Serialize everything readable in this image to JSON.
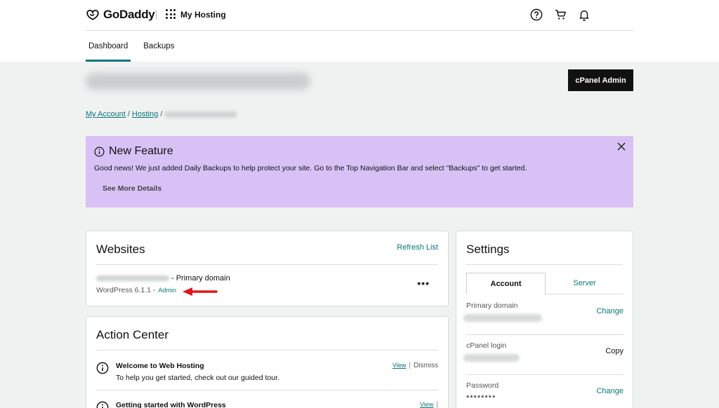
{
  "header": {
    "brand": "GoDaddy",
    "product": "My Hosting",
    "icons": [
      "help-icon",
      "cart-icon",
      "bell-icon"
    ]
  },
  "subnav": {
    "tabs": [
      {
        "label": "Dashboard",
        "active": true
      },
      {
        "label": "Backups",
        "active": false
      }
    ]
  },
  "title": {
    "cpanel_label": "cPanel Admin"
  },
  "breadcrumb": {
    "items": [
      "My Account",
      "Hosting"
    ],
    "separator": "/"
  },
  "banner": {
    "title": "New Feature",
    "body": "Good news! We just added Daily Backups to help protect your site. Go to the Top Navigation Bar and select \"Backups\" to get started.",
    "more_label": "See More Details",
    "close_icon": "close-icon",
    "color": "#d8c1f5"
  },
  "websites": {
    "title": "Websites",
    "refresh_label": "Refresh List",
    "site": {
      "domain_suffix": "- Primary domain",
      "platform": "WordPress 6.1.1 -",
      "admin_label": "Admin",
      "menu_label": "•••"
    }
  },
  "action_center": {
    "title": "Action Center",
    "items": [
      {
        "title": "Welcome to Web Hosting",
        "desc": "To help you get started, check out our guided tour.",
        "view_label": "View",
        "dismiss_label": "Dismiss"
      },
      {
        "title": "Getting started with WordPress",
        "view_label": "View"
      }
    ]
  },
  "settings": {
    "title": "Settings",
    "tabs": [
      {
        "label": "Account",
        "active": true
      },
      {
        "label": "Server",
        "active": false
      }
    ],
    "rows": [
      {
        "label": "Primary domain",
        "action": "Change"
      },
      {
        "label": "cPanel login",
        "action": "Copy"
      },
      {
        "label": "Password",
        "value": "********",
        "action": "Change"
      }
    ]
  },
  "colors": {
    "accent": "#09757a",
    "primary_button": "#111111",
    "arrow": "#e0161b"
  }
}
